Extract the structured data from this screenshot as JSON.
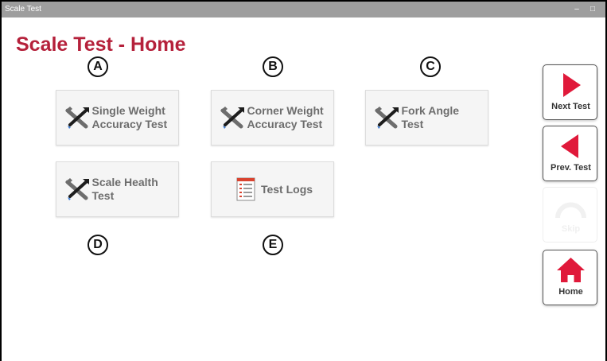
{
  "window": {
    "title": "Scale Test",
    "minimize_glyph": "–",
    "maximize_glyph": "□"
  },
  "page": {
    "title": "Scale Test - Home"
  },
  "markers": [
    "A",
    "B",
    "C",
    "D",
    "E"
  ],
  "tiles": [
    {
      "label": "Single Weight Accuracy Test",
      "icon": "tools-icon"
    },
    {
      "label": "Corner Weight Accuracy Test",
      "icon": "tools-icon"
    },
    {
      "label": "Fork Angle Test",
      "icon": "tools-icon"
    },
    {
      "label": "Scale Health Test",
      "icon": "tools-icon"
    },
    {
      "label": "Test Logs",
      "icon": "log-document-icon"
    }
  ],
  "side_nav": {
    "next": {
      "label": "Next Test",
      "icon": "play-right-icon",
      "enabled": true
    },
    "prev": {
      "label": "Prev. Test",
      "icon": "play-left-icon",
      "enabled": true
    },
    "skip": {
      "label": "Skip",
      "icon": "skip-arc-icon",
      "enabled": false
    },
    "home": {
      "label": "Home",
      "icon": "home-icon",
      "enabled": true
    }
  },
  "colors": {
    "accent": "#b5213b",
    "nav_icon": "#e0193a",
    "tile_text": "#6d6d6d",
    "tile_bg": "#f5f5f5",
    "titlebar": "#9e9e9e"
  }
}
